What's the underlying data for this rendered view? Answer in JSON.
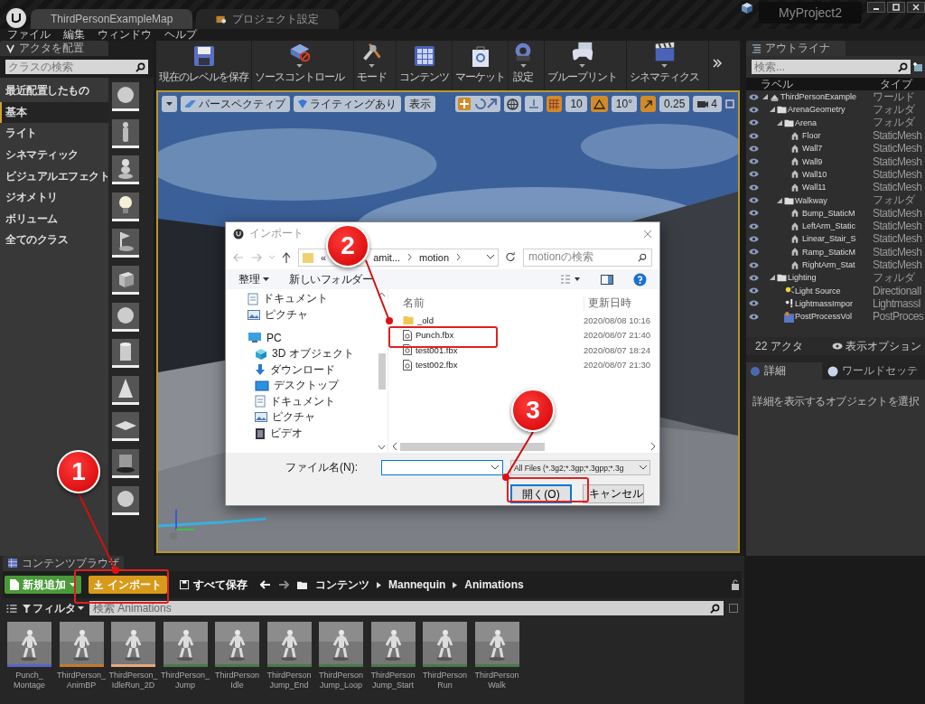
{
  "title_bar": {
    "tabs": [
      {
        "label": "ThirdPersonExampleMap",
        "selected": true
      },
      {
        "label": "プロジェクト設定",
        "selected": false
      }
    ],
    "project": "MyProject2"
  },
  "menu": [
    "ファイル",
    "編集",
    "ウィンドウ",
    "ヘルプ"
  ],
  "place_actors": {
    "tab": "アクタを配置",
    "search": {
      "placeholder": "クラスの検索"
    },
    "categories": [
      {
        "label": "最近配置したもの",
        "selected": false
      },
      {
        "label": "基本",
        "selected": true
      },
      {
        "label": "ライト",
        "selected": false
      },
      {
        "label": "シネマティック",
        "selected": false
      },
      {
        "label": "ビジュアルエフェクト",
        "selected": false
      },
      {
        "label": "ジオメトリ",
        "selected": false
      },
      {
        "label": "ボリューム",
        "selected": false
      },
      {
        "label": "全てのクラス",
        "selected": false
      }
    ]
  },
  "toolbar": [
    {
      "label": "現在のレベルを保存",
      "kind": "save",
      "dropdown": false
    },
    {
      "label": "ソースコントロール",
      "kind": "source",
      "dropdown": true
    },
    {
      "label": "モード",
      "kind": "modes",
      "dropdown": true
    },
    {
      "label": "コンテンツ",
      "kind": "content",
      "dropdown": false
    },
    {
      "label": "マーケット",
      "kind": "market",
      "dropdown": false
    },
    {
      "label": "設定",
      "kind": "settings",
      "dropdown": true
    },
    {
      "label": "ブループリント",
      "kind": "blueprint",
      "dropdown": true
    },
    {
      "label": "シネマティクス",
      "kind": "cinematics",
      "dropdown": true
    }
  ],
  "viewport": {
    "view_mode": "パースペクティブ",
    "lighting": "ライティングあり",
    "show": "表示",
    "snaps": [
      {
        "kind": "grid",
        "value": "10",
        "on": true
      },
      {
        "kind": "angle",
        "value": "10°",
        "on": true
      },
      {
        "kind": "scale",
        "value": "0.25",
        "on": true
      }
    ],
    "camera_speed": "4"
  },
  "outliner": {
    "tab": "アウトライナ",
    "search": {
      "placeholder": "検索..."
    },
    "columns": [
      "ラベル",
      "タイプ"
    ],
    "tree": [
      {
        "label": "ThirdPersonExample",
        "type": "ワールド",
        "kind": "world",
        "expanded": true,
        "children": [
          {
            "label": "ArenaGeometry",
            "type": "フォルダ",
            "kind": "folder",
            "expanded": true,
            "children": [
              {
                "label": "Arena",
                "type": "フォルダ",
                "kind": "folder",
                "expanded": true,
                "children": [
                  {
                    "label": "Floor",
                    "type": "StaticMesh",
                    "kind": "mesh"
                  },
                  {
                    "label": "Wall7",
                    "type": "StaticMesh",
                    "kind": "mesh"
                  },
                  {
                    "label": "Wall9",
                    "type": "StaticMesh",
                    "kind": "mesh"
                  },
                  {
                    "label": "Wall10",
                    "type": "StaticMesh",
                    "kind": "mesh"
                  },
                  {
                    "label": "Wall11",
                    "type": "StaticMesh",
                    "kind": "mesh"
                  }
                ]
              },
              {
                "label": "Walkway",
                "type": "フォルダ",
                "kind": "folder",
                "expanded": true,
                "children": [
                  {
                    "label": "Bump_StaticM",
                    "type": "StaticMesh",
                    "kind": "mesh"
                  },
                  {
                    "label": "LeftArm_Static",
                    "type": "StaticMesh",
                    "kind": "mesh"
                  },
                  {
                    "label": "Linear_Stair_S",
                    "type": "StaticMesh",
                    "kind": "mesh"
                  },
                  {
                    "label": "Ramp_StaticM",
                    "type": "StaticMesh",
                    "kind": "mesh"
                  },
                  {
                    "label": "RightArm_Stat",
                    "type": "StaticMesh",
                    "kind": "mesh"
                  }
                ]
              }
            ]
          },
          {
            "label": "Lighting",
            "type": "フォルダ",
            "kind": "folder",
            "expanded": true,
            "children": [
              {
                "label": "Light Source",
                "type": "DirectionalI",
                "kind": "light"
              },
              {
                "label": "LightmassImpor",
                "type": "LightmassI",
                "kind": "lightmass"
              },
              {
                "label": "PostProcessVol",
                "type": "PostProces",
                "kind": "postprocess"
              }
            ]
          }
        ]
      }
    ],
    "count": "22 アクタ",
    "view_options": "表示オプション"
  },
  "details": {
    "tabs": [
      {
        "label": "詳細",
        "selected": true
      },
      {
        "label": "ワールドセッテ",
        "selected": false
      }
    ],
    "hint": "詳細を表示するオブジェクトを選択"
  },
  "content_browser": {
    "tab": "コンテンツブラウザ",
    "add_new": "新規追加",
    "import": "インポート",
    "save_all": "すべて保存",
    "path": [
      "コンテンツ",
      "Mannequin",
      "Animations"
    ],
    "filter": "フィルタ",
    "search": {
      "placeholder": "検索 Animations"
    },
    "assets": [
      {
        "label": "Punch_\nMontage",
        "color": "#5a63c8"
      },
      {
        "label": "ThirdPerson_\nAnimBP",
        "color": "#c8782a"
      },
      {
        "label": "ThirdPerson_\nIdleRun_2D",
        "color": "#e8a878"
      },
      {
        "label": "ThirdPerson_\nJump",
        "color": "#4a7a4a"
      },
      {
        "label": "ThirdPerson\nIdle",
        "color": "#4a7a4a"
      },
      {
        "label": "ThirdPerson\nJump_End",
        "color": "#4a7a4a"
      },
      {
        "label": "ThirdPerson\nJump_Loop",
        "color": "#4a7a4a"
      },
      {
        "label": "ThirdPerson\nJump_Start",
        "color": "#4a7a4a"
      },
      {
        "label": "ThirdPerson\nRun",
        "color": "#4a7a4a"
      },
      {
        "label": "ThirdPerson\nWalk",
        "color": "#4a7a4a"
      }
    ]
  },
  "import_dialog": {
    "title": "インポート",
    "path": [
      "«",
      "amit...",
      "motion"
    ],
    "search": {
      "placeholder": "motionの検索"
    },
    "organize": "整理",
    "new_folder": "新しいフォルダー",
    "nav": [
      {
        "label": "ドキュメント",
        "kind": "doc"
      },
      {
        "label": "ピクチャ",
        "kind": "pic"
      },
      {
        "label": "PC",
        "kind": "pc",
        "children": [
          {
            "label": "3D オブジェクト",
            "kind": "obj3d"
          },
          {
            "label": "ダウンロード",
            "kind": "download"
          },
          {
            "label": "デスクトップ",
            "kind": "desktop"
          },
          {
            "label": "ドキュメント",
            "kind": "doc"
          },
          {
            "label": "ピクチャ",
            "kind": "pic"
          },
          {
            "label": "ビデオ",
            "kind": "video"
          }
        ]
      }
    ],
    "columns": [
      "名前",
      "更新日時"
    ],
    "files": [
      {
        "name": "_old",
        "modified": "2020/08/08 10:16",
        "kind": "folder"
      },
      {
        "name": "Punch.fbx",
        "modified": "2020/08/07 21:40",
        "kind": "file"
      },
      {
        "name": "test001.fbx",
        "modified": "2020/08/07 18:24",
        "kind": "file"
      },
      {
        "name": "test002.fbx",
        "modified": "2020/08/07 21:30",
        "kind": "file"
      }
    ],
    "file_name_label": "ファイル名(N):",
    "file_type": "All Files (*.3g2;*.3gp;*.3gpp;*.3g",
    "open": "開く(O)",
    "cancel": "キャンセル"
  },
  "annotations": [
    "1",
    "2",
    "3"
  ]
}
